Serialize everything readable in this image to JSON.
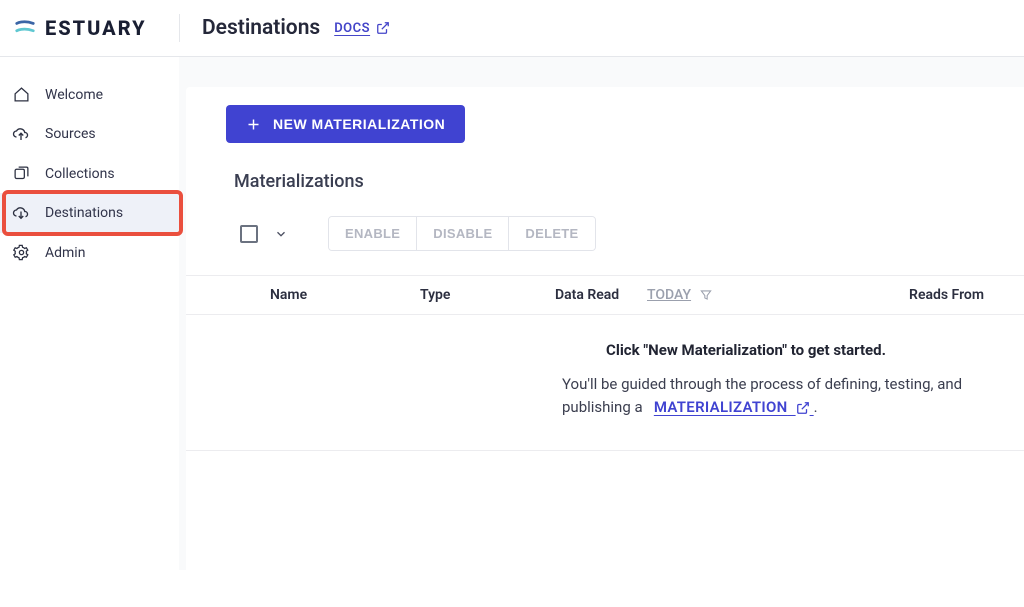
{
  "brand": "ESTUARY",
  "header": {
    "title": "Destinations",
    "docs_label": "DOCS"
  },
  "sidebar": {
    "items": [
      {
        "label": "Welcome"
      },
      {
        "label": "Sources"
      },
      {
        "label": "Collections"
      },
      {
        "label": "Destinations"
      },
      {
        "label": "Admin"
      }
    ]
  },
  "panel": {
    "new_button": "NEW MATERIALIZATION",
    "section_title": "Materializations",
    "actions": {
      "enable": "ENABLE",
      "disable": "DISABLE",
      "delete": "DELETE"
    },
    "columns": {
      "name": "Name",
      "type": "Type",
      "data_read": "Data Read",
      "today": "TODAY",
      "reads_from": "Reads From"
    },
    "empty": {
      "title": "Click \"New Materialization\" to get started.",
      "body_prefix": "You'll be guided through the process of defining, testing, and publishing a",
      "link_label": "MATERIALIZATION",
      "body_suffix": "."
    }
  }
}
